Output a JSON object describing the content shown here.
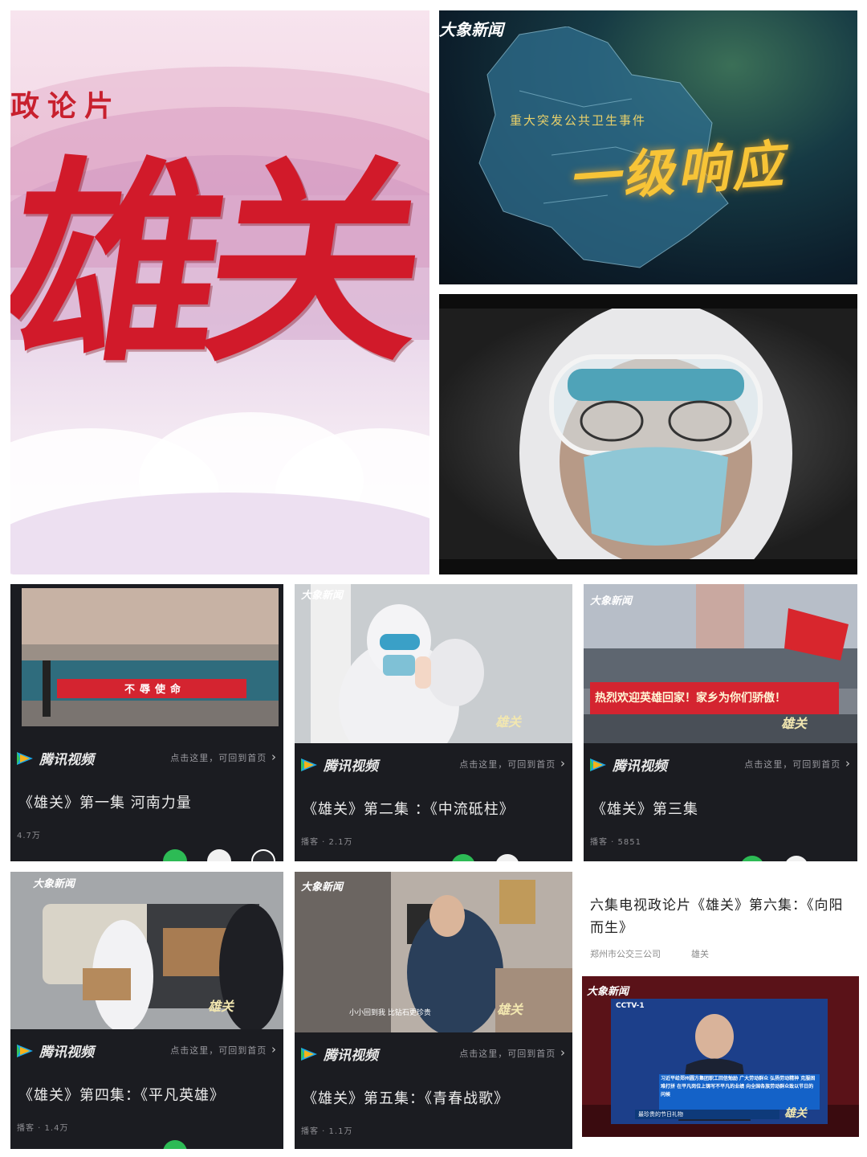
{
  "poster": {
    "subtitle": "政论片",
    "title": "雄关"
  },
  "map_tile": {
    "logo": "大象新闻",
    "caption": "重大突发公共卫生事件",
    "title": "一级响应"
  },
  "cards": [
    {
      "brand": "腾讯视频",
      "back_link": "点击这里，可回到首页",
      "title": "《雄关》第一集 河南力量",
      "meta": "4.7万",
      "banner": "不辱使命"
    },
    {
      "brand": "腾讯视频",
      "back_link": "点击这里，可回到首页",
      "title": "《雄关》第二集 ：《中流砥柱》",
      "meta": "播客 · 2.1万",
      "logo": "大象新闻",
      "watermark": "雄关"
    },
    {
      "brand": "腾讯视频",
      "back_link": "点击这里，可回到首页",
      "title": "《雄关》第三集",
      "meta": "播客 · 5851",
      "logo": "大象新闻",
      "banner": "热烈欢迎英雄回家！家乡为你们骄傲！",
      "watermark": "雄关"
    },
    {
      "brand": "腾讯视频",
      "back_link": "点击这里，可回到首页",
      "title": "《雄关》第四集：《平凡英雄》",
      "meta": "播客 · 1.4万",
      "logo": "大象新闻",
      "watermark": "雄关"
    },
    {
      "brand": "腾讯视频",
      "back_link": "点击这里，可回到首页",
      "title": "《雄关》第五集：《青春战歌》",
      "meta": "播客 · 1.1万",
      "logo": "大象新闻",
      "subtitle": "小小回到我 比钻石更珍贵",
      "watermark": "雄关"
    }
  ],
  "article": {
    "title": "六集电视政论片《雄关》第六集：《向阳而生》",
    "source": "郑州市公交三公司",
    "tag": "雄关",
    "tv_logo": "大象新闻",
    "tv_channel": "CCTV-1",
    "tv_headline": "习近平给郑州圆方集团职工回信勉励 广大劳动群众 弘扬劳动精神 克服困难打拼 在平凡岗位上铸写不平凡的业绩 向全国各族劳动群众致以节日的问候",
    "tv_caption": "最珍贵的节日礼物",
    "watermark": "雄关"
  },
  "colors": {
    "title_red": "#d11a2a",
    "card_bg": "#1b1c21",
    "gold": "#f7c437",
    "banner_red": "#d42430"
  }
}
